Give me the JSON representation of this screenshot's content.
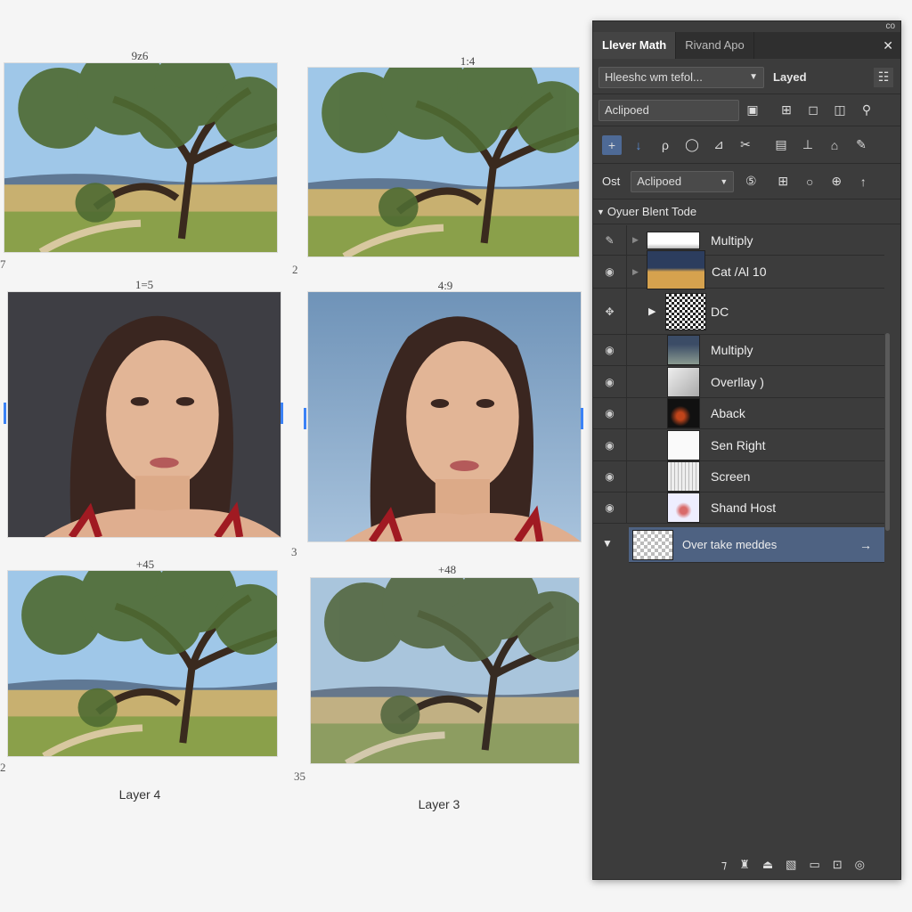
{
  "canvas": {
    "images": [
      {
        "label": "9z6",
        "tag": "7",
        "kind": "tree"
      },
      {
        "label": "1:4",
        "tag": "2",
        "kind": "tree"
      },
      {
        "label": "1=5",
        "tag": "",
        "kind": "portrait-dark"
      },
      {
        "label": "4:9",
        "tag": "3",
        "kind": "portrait-blue"
      },
      {
        "label": "+45",
        "tag": "2",
        "kind": "tree"
      },
      {
        "label": "+48",
        "tag": "35",
        "kind": "tree"
      }
    ],
    "captions": [
      "Layer 4",
      "Layer 3"
    ]
  },
  "panel": {
    "corner": "co",
    "tabs": [
      {
        "label": "Llever Math",
        "active": true
      },
      {
        "label": "Rivand Apo",
        "active": false
      }
    ],
    "close_icon": "close-icon",
    "preset_dropdown": {
      "value": "Hleeshc wm tefol..."
    },
    "layered_label": "Layed",
    "mode_field": {
      "value": "Aclipoed"
    },
    "opacity_label": "Ost",
    "blend_dropdown": {
      "value": "Aclipoed"
    },
    "section_title": "Oyuer Blent Tode",
    "layers": [
      {
        "name": "Multiply",
        "eye": "brush-icon"
      },
      {
        "name": "Cat /Al 10",
        "eye": "eye-icon"
      },
      {
        "name": "DC",
        "eye": "move-icon"
      },
      {
        "name": "Multiply",
        "eye": "eye-icon"
      },
      {
        "name": "Overllay )",
        "eye": "eye-icon"
      },
      {
        "name": "Aback",
        "eye": "eye-icon"
      },
      {
        "name": "Sen Right",
        "eye": "eye-icon"
      },
      {
        "name": "Screen",
        "eye": "eye-icon"
      },
      {
        "name": "Shand Host",
        "eye": "eye-icon"
      }
    ],
    "selected_layer": {
      "name": "Over take meddes"
    },
    "accent": "#4e6282"
  }
}
